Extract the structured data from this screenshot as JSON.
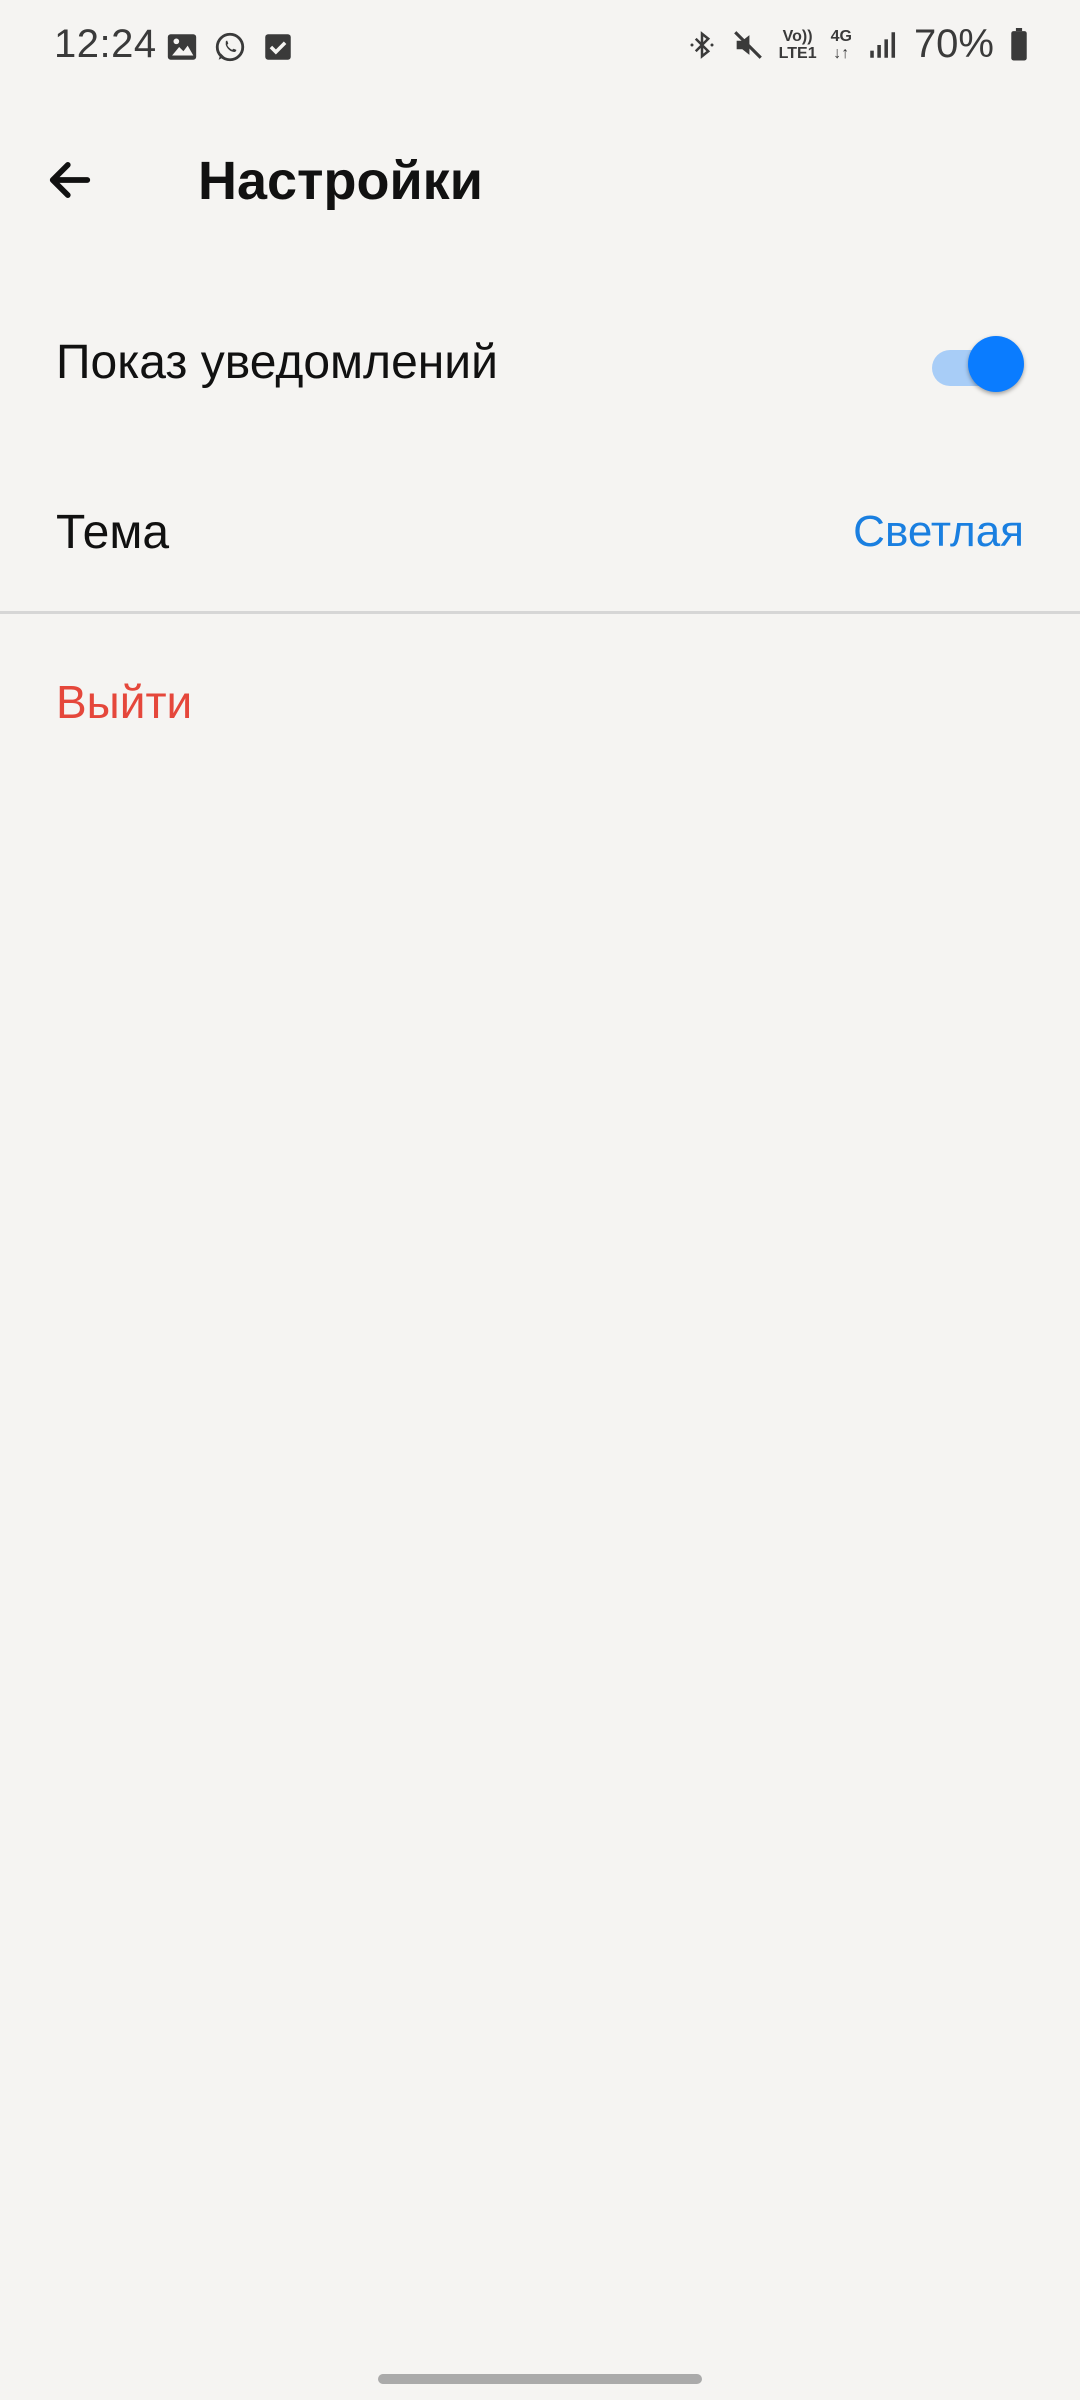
{
  "status_bar": {
    "time": "12:24",
    "notification_icons": [
      "gallery-icon",
      "whatsapp-icon",
      "checkbox-icon"
    ],
    "system_icons": [
      "bluetooth-icon",
      "mute-icon",
      "volte-icon",
      "network-4g-icon",
      "signal-icon"
    ],
    "volte_line1": "Vo))",
    "volte_line2": "LTE1",
    "network_label": "4G",
    "battery_percent": "70%"
  },
  "app_bar": {
    "title": "Настройки",
    "back_icon": "arrow-left-icon"
  },
  "settings": {
    "notifications": {
      "label": "Показ уведомлений",
      "enabled": true
    },
    "theme": {
      "label": "Тема",
      "value": "Светлая"
    },
    "logout": {
      "label": "Выйти"
    }
  },
  "colors": {
    "background": "#f5f4f2",
    "accent": "#0a7cff",
    "link": "#1a7fe0",
    "danger": "#e5473b"
  }
}
